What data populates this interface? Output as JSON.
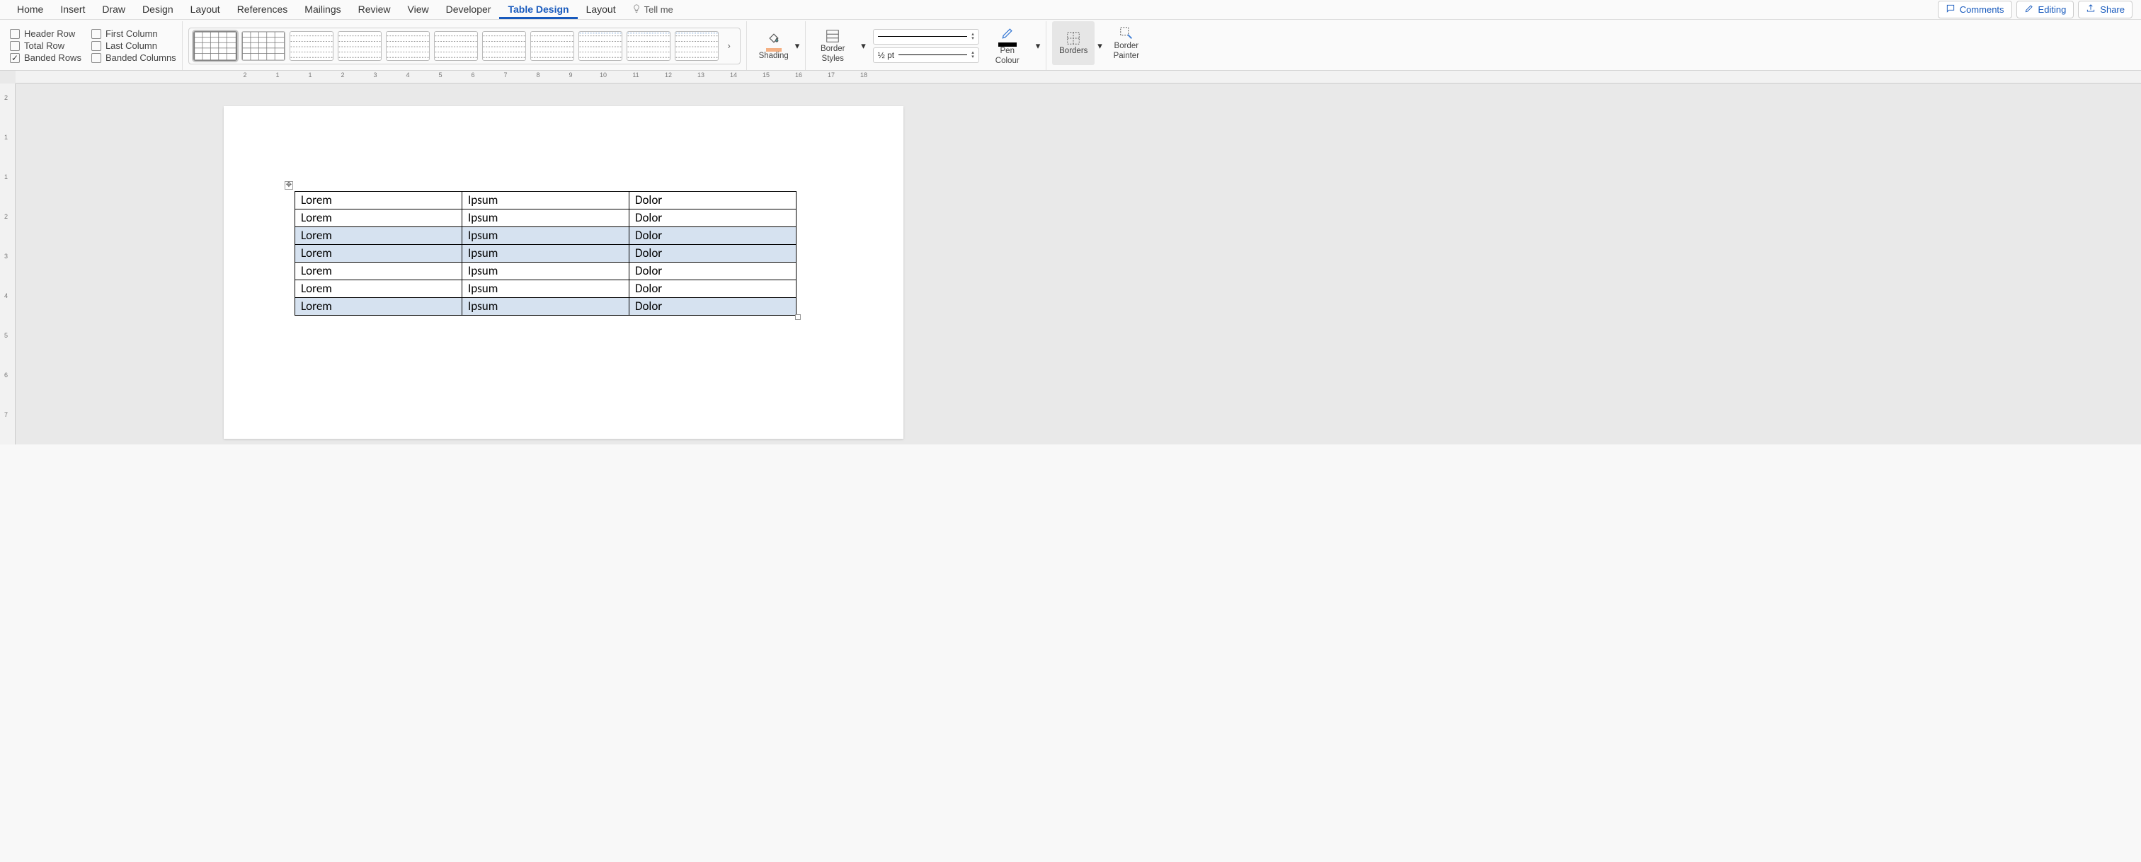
{
  "menu": {
    "tabs": [
      "Home",
      "Insert",
      "Draw",
      "Design",
      "Layout",
      "References",
      "Mailings",
      "Review",
      "View",
      "Developer",
      "Table Design",
      "Layout"
    ],
    "activeIndex": 10,
    "tellme": "Tell me",
    "comments": "Comments",
    "editing": "Editing",
    "share": "Share"
  },
  "styleOptions": {
    "headerRow": {
      "label": "Header Row",
      "checked": false
    },
    "totalRow": {
      "label": "Total Row",
      "checked": false
    },
    "bandedRows": {
      "label": "Banded Rows",
      "checked": true
    },
    "firstColumn": {
      "label": "First Column",
      "checked": false
    },
    "lastColumn": {
      "label": "Last Column",
      "checked": false
    },
    "bandedCols": {
      "label": "Banded Columns",
      "checked": false
    }
  },
  "shading": {
    "label": "Shading"
  },
  "borderStyles": {
    "label": "Border\nStyles"
  },
  "lineWeight": {
    "label": "½ pt"
  },
  "penColour": {
    "label": "Pen\nColour"
  },
  "borders": {
    "label": "Borders"
  },
  "borderPainter": {
    "label": "Border\nPainter"
  },
  "ruler": {
    "hNumbers": [
      "2",
      "1",
      "1",
      "2",
      "3",
      "4",
      "5",
      "6",
      "7",
      "8",
      "9",
      "10",
      "11",
      "12",
      "13",
      "14",
      "15",
      "16",
      "17",
      "18"
    ],
    "vNumbers": [
      "2",
      "1",
      "1",
      "2",
      "3",
      "4",
      "5",
      "6",
      "7"
    ]
  },
  "table": {
    "rows": [
      {
        "sel": false,
        "cells": [
          "Lorem",
          "Ipsum",
          "Dolor"
        ]
      },
      {
        "sel": false,
        "cells": [
          "Lorem",
          "Ipsum",
          "Dolor"
        ]
      },
      {
        "sel": true,
        "cells": [
          "Lorem",
          "Ipsum",
          "Dolor"
        ]
      },
      {
        "sel": true,
        "cells": [
          "Lorem",
          "Ipsum",
          "Dolor"
        ]
      },
      {
        "sel": false,
        "cells": [
          "Lorem",
          "Ipsum",
          "Dolor"
        ]
      },
      {
        "sel": false,
        "cells": [
          "Lorem",
          "Ipsum",
          "Dolor"
        ]
      },
      {
        "sel": true,
        "cells": [
          "Lorem",
          "Ipsum",
          "Dolor"
        ]
      }
    ]
  }
}
